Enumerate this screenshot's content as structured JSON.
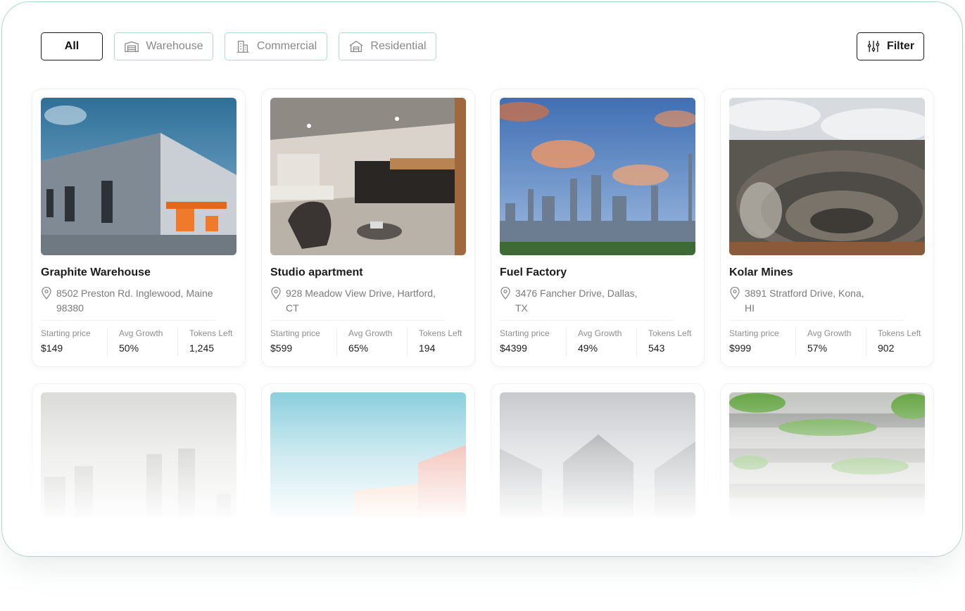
{
  "tabs": [
    {
      "label": "All",
      "icon": "none"
    },
    {
      "label": "Warehouse",
      "icon": "warehouse-icon"
    },
    {
      "label": "Commercial",
      "icon": "building-icon"
    },
    {
      "label": "Residential",
      "icon": "house-icon"
    }
  ],
  "filter": {
    "label": "Filter",
    "icon": "sliders-icon"
  },
  "stat_labels": {
    "price": "Starting price",
    "growth": "Avg Growth",
    "tokens": "Tokens Left"
  },
  "cards": [
    {
      "title": "Graphite Warehouse",
      "address_line1": "8502 Preston Rd. Inglewood, Maine",
      "address_line2": "98380",
      "price": "$149",
      "growth": "50%",
      "tokens": "1,245"
    },
    {
      "title": "Studio apartment",
      "address_line1": "928 Meadow View Drive, Hartford,",
      "address_line2": "CT",
      "price": "$599",
      "growth": "65%",
      "tokens": "194"
    },
    {
      "title": "Fuel Factory",
      "address_line1": "3476 Fancher Drive, Dallas,",
      "address_line2": "TX",
      "price": "$4399",
      "growth": "49%",
      "tokens": "543"
    },
    {
      "title": "Kolar Mines",
      "address_line1": "3891 Stratford Drive, Kona,",
      "address_line2": "HI",
      "price": "$999",
      "growth": "57%",
      "tokens": "902"
    }
  ],
  "colors": {
    "accent_border": "#a9d9c6",
    "text": "#1c1c1c",
    "muted": "#7b7b7b"
  }
}
